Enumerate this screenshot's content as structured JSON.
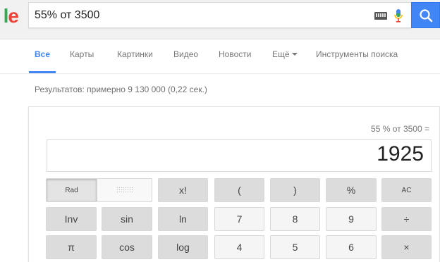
{
  "search": {
    "query": "55% от 3500",
    "logo_fragment": "le"
  },
  "tabs": [
    {
      "label": "Все",
      "active": true
    },
    {
      "label": "Карты"
    },
    {
      "label": "Картинки"
    },
    {
      "label": "Видео"
    },
    {
      "label": "Новости"
    },
    {
      "label": "Ещё"
    },
    {
      "label": "Инструменты поиска"
    }
  ],
  "results": {
    "stats": "Результатов: примерно 9 130 000 (0,22 сек.)"
  },
  "calculator": {
    "history": "55 % от 3500 =",
    "display": "1925",
    "buttons": {
      "rad": "Rad",
      "fact": "x!",
      "lparen": "(",
      "rparen": ")",
      "percent": "%",
      "ac": "AC",
      "inv": "Inv",
      "sin": "sin",
      "ln": "ln",
      "seven": "7",
      "eight": "8",
      "nine": "9",
      "divide": "÷",
      "pi": "π",
      "cos": "cos",
      "log": "log",
      "four": "4",
      "five": "5",
      "six": "6",
      "multiply": "×"
    }
  },
  "icons": {
    "keyboard": "keyboard-icon",
    "mic": "microphone-icon",
    "search": "search-icon"
  },
  "colors": {
    "accent": "#4285f4",
    "search_button": "#4285f4",
    "calc_dark_button": "#dcdcdc",
    "calc_light_button": "#f5f5f5"
  }
}
